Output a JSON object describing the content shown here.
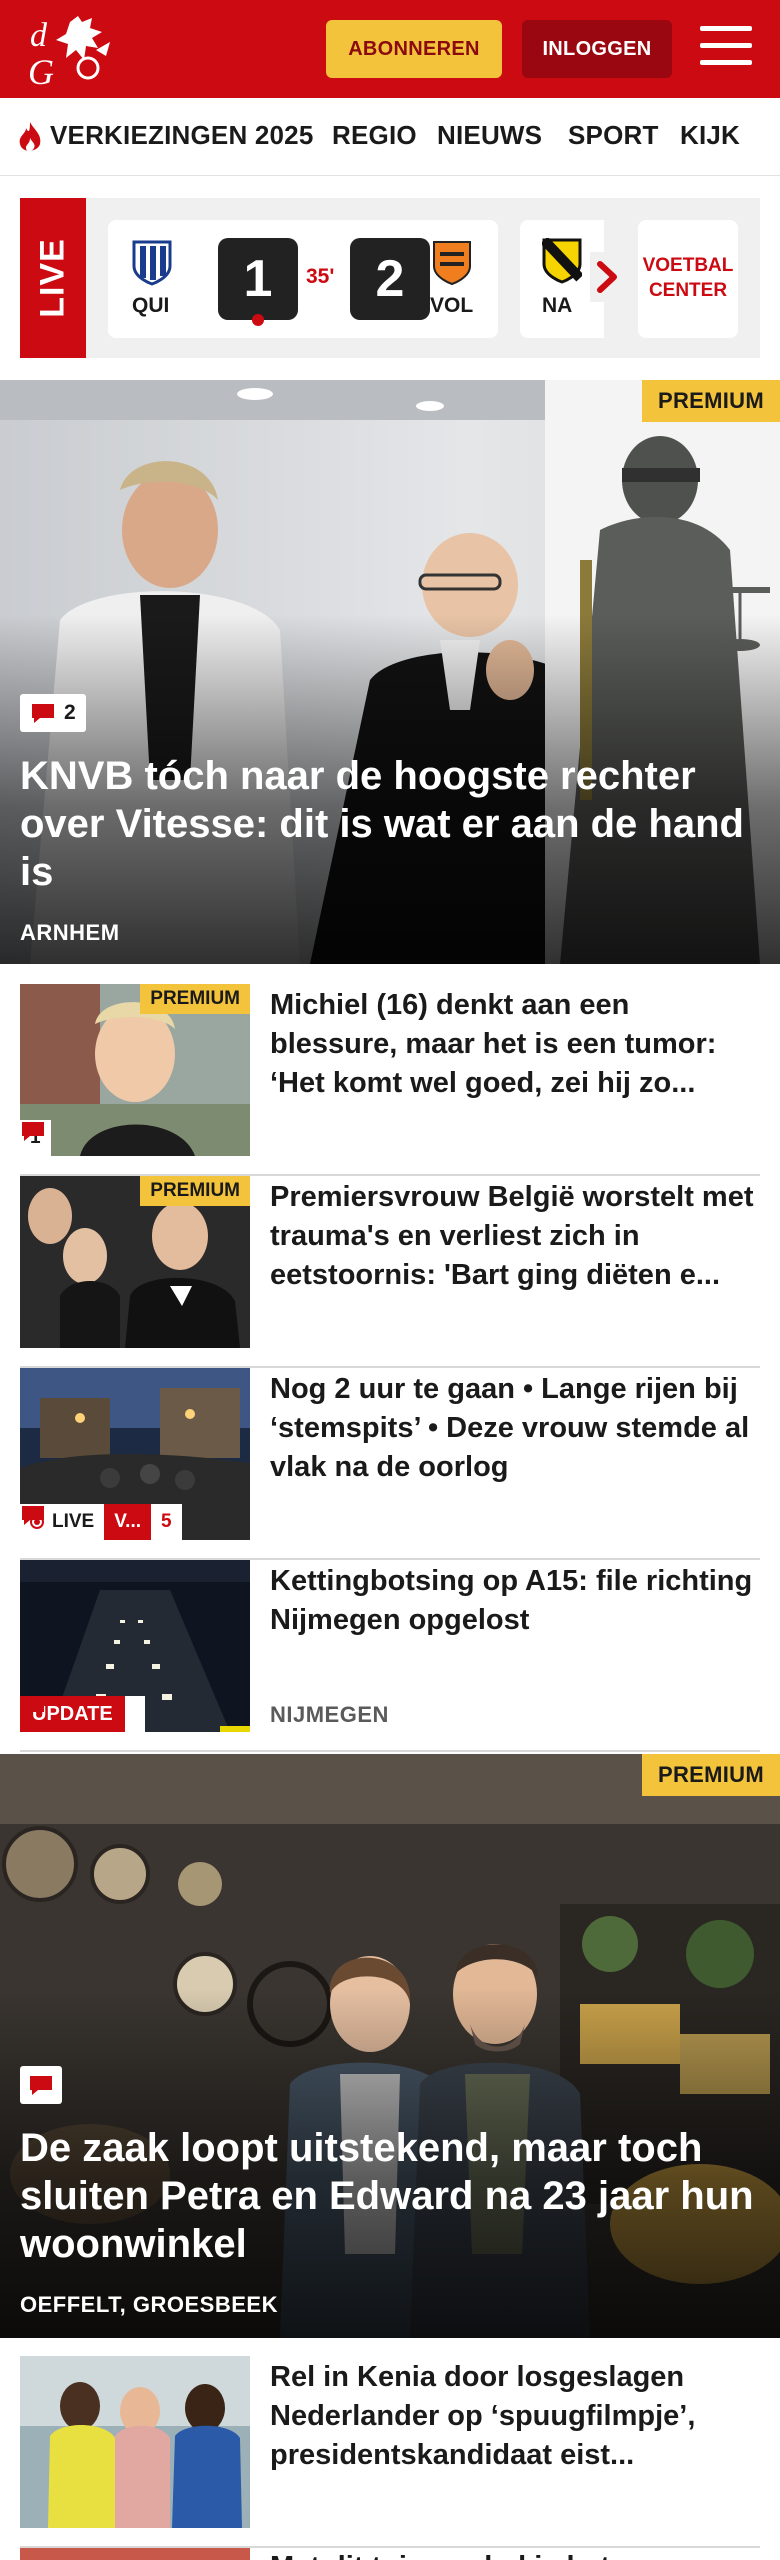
{
  "header": {
    "subscribe_label": "ABONNEREN",
    "login_label": "INLOGGEN",
    "brand_color": "#cc0a12"
  },
  "nav": {
    "items": [
      "VERKIEZINGEN 2025",
      "REGIO",
      "NIEUWS",
      "SPORT",
      "KIJK"
    ]
  },
  "live": {
    "tag": "LIVE",
    "match": {
      "home": "QUI",
      "away": "VOL",
      "home_score": "1",
      "away_score": "2",
      "minute": "35'"
    },
    "next_match_team": "NA",
    "voetbal_center_line1": "VOETBAL",
    "voetbal_center_line2": "CENTER"
  },
  "hero1": {
    "badge": "PREMIUM",
    "comments": "2",
    "title": "KNVB tóch naar de hoogste rechter over Vitesse: dit is wat er aan de hand is",
    "place": "ARNHEM"
  },
  "articles": [
    {
      "badge": "PREMIUM",
      "comments": "1",
      "title": "Michiel (16) denkt aan een blessure, maar het is een tumor: ‘Het komt wel goed, zei hij zo...",
      "place": ""
    },
    {
      "badge": "PREMIUM",
      "comments": "",
      "title": "Premiersvrouw België worstelt met trauma's en verliest zich in eetstoornis: 'Bart ging diëten e...",
      "place": ""
    },
    {
      "badge": "",
      "live_label": "LIVE",
      "live_extra": "V...",
      "comments": "5",
      "title": "Nog 2 uur te gaan • Lange rijen bij ‘stemspits’ • Deze vrouw stemde al vlak na de oorlog",
      "place": ""
    },
    {
      "badge": "",
      "update_label": "UPDATE",
      "comments": "",
      "title": "Kettingbotsing op A15: file richting Nijmegen opgelost",
      "place": "NIJMEGEN"
    }
  ],
  "hero2": {
    "badge": "PREMIUM",
    "title": "De zaak loopt uitstekend, maar toch sluiten Petra en Edward na 23 jaar hun woonwinkel",
    "place": "OEFFELT, GROESBEEK"
  },
  "article_bottom": {
    "title": "Rel in Kenia door losgeslagen Nederlander op ‘spuugfilmpje’, presidentskandidaat eist...",
    "title_partial": "Met dit tuinmeubel is het..."
  }
}
